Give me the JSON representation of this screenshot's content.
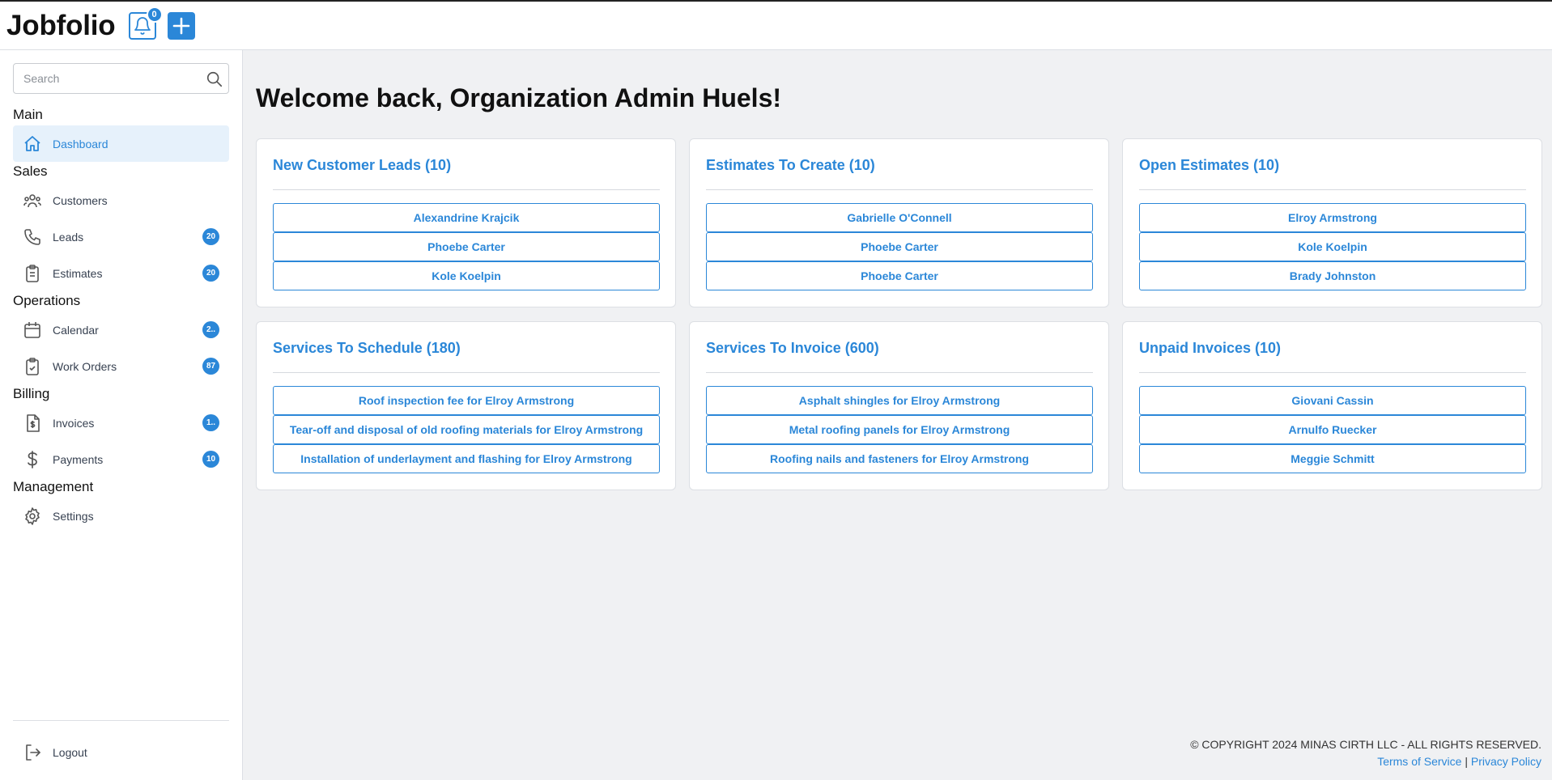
{
  "header": {
    "logo": "Jobfolio",
    "notification_count": "0",
    "bell_icon": "bell-icon",
    "add_icon": "plus-icon"
  },
  "sidebar": {
    "search_placeholder": "Search",
    "sections": [
      {
        "title": "Main"
      },
      {
        "title": "Sales"
      },
      {
        "title": "Operations"
      },
      {
        "title": "Billing"
      },
      {
        "title": "Management"
      }
    ],
    "items": [
      {
        "label": "Dashboard",
        "icon": "home-icon",
        "active": true
      },
      {
        "label": "Customers",
        "icon": "users-icon"
      },
      {
        "label": "Leads",
        "icon": "phone-icon",
        "count": "20"
      },
      {
        "label": "Estimates",
        "icon": "clipboard-icon",
        "count": "20"
      },
      {
        "label": "Calendar",
        "icon": "calendar-icon",
        "count": "2.."
      },
      {
        "label": "Work Orders",
        "icon": "clipboard-check-icon",
        "count": "87"
      },
      {
        "label": "Invoices",
        "icon": "invoice-icon",
        "count": "1.."
      },
      {
        "label": "Payments",
        "icon": "dollar-icon",
        "count": "10"
      },
      {
        "label": "Settings",
        "icon": "gear-icon"
      }
    ],
    "logout": {
      "label": "Logout",
      "icon": "logout-icon"
    }
  },
  "main": {
    "welcome": "Welcome back, Organization Admin Huels!",
    "cards": [
      {
        "title": "New Customer Leads (10)",
        "items": [
          "Alexandrine Krajcik",
          "Phoebe Carter",
          "Kole Koelpin"
        ]
      },
      {
        "title": "Estimates To Create (10)",
        "items": [
          "Gabrielle O'Connell",
          "Phoebe Carter",
          "Phoebe Carter"
        ]
      },
      {
        "title": "Open Estimates (10)",
        "items": [
          "Elroy Armstrong",
          "Kole Koelpin",
          "Brady Johnston"
        ]
      },
      {
        "title": "Services To Schedule (180)",
        "items": [
          "Roof inspection fee for Elroy Armstrong",
          "Tear-off and disposal of old roofing materials for Elroy Armstrong",
          "Installation of underlayment and flashing for Elroy Armstrong"
        ]
      },
      {
        "title": "Services To Invoice (600)",
        "items": [
          "Asphalt shingles for Elroy Armstrong",
          "Metal roofing panels for Elroy Armstrong",
          "Roofing nails and fasteners for Elroy Armstrong"
        ]
      },
      {
        "title": "Unpaid Invoices (10)",
        "items": [
          "Giovani Cassin",
          "Arnulfo Ruecker",
          "Meggie Schmitt"
        ]
      }
    ]
  },
  "footer": {
    "copyright": "© COPYRIGHT 2024 MINAS CIRTH LLC - ALL RIGHTS RESERVED.",
    "terms": "Terms of Service",
    "separator": "|",
    "privacy": "Privacy Policy"
  },
  "colors": {
    "accent": "#2b87d8",
    "background": "#f0f1f3",
    "active_item_bg": "#e6f1fb"
  }
}
